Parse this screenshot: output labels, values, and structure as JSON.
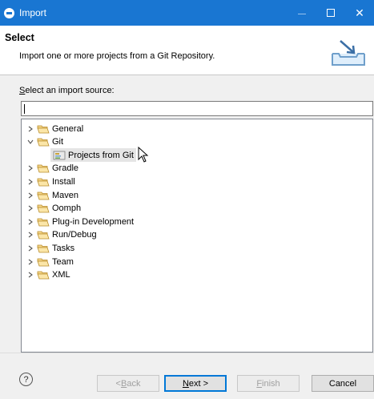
{
  "window": {
    "title": "Import"
  },
  "header": {
    "title": "Select",
    "description": "Import one or more projects from a Git Repository."
  },
  "source": {
    "label_accel": "S",
    "label_rest": "elect an import source:",
    "search_value": ""
  },
  "tree": {
    "items": [
      {
        "label": "General",
        "expanded": false,
        "icon": "folder-icon"
      },
      {
        "label": "Git",
        "expanded": true,
        "icon": "folder-icon"
      },
      {
        "label": "Projects from Git",
        "child": true,
        "selected": true,
        "icon": "git-projects-icon"
      },
      {
        "label": "Gradle",
        "expanded": false,
        "icon": "folder-icon"
      },
      {
        "label": "Install",
        "expanded": false,
        "icon": "folder-icon"
      },
      {
        "label": "Maven",
        "expanded": false,
        "icon": "folder-icon"
      },
      {
        "label": "Oomph",
        "expanded": false,
        "icon": "folder-icon"
      },
      {
        "label": "Plug-in Development",
        "expanded": false,
        "icon": "folder-icon"
      },
      {
        "label": "Run/Debug",
        "expanded": false,
        "icon": "folder-icon"
      },
      {
        "label": "Tasks",
        "expanded": false,
        "icon": "folder-icon"
      },
      {
        "label": "Team",
        "expanded": false,
        "icon": "folder-icon"
      },
      {
        "label": "XML",
        "expanded": false,
        "icon": "folder-icon"
      }
    ]
  },
  "buttons": {
    "back": {
      "pre": "< ",
      "accel": "B",
      "post": "ack",
      "enabled": false
    },
    "next": {
      "accel": "N",
      "post": "ext >",
      "enabled": true
    },
    "finish": {
      "accel": "F",
      "post": "inish",
      "enabled": false
    },
    "cancel": {
      "label": "Cancel",
      "enabled": true
    }
  },
  "colors": {
    "titlebar": "#1976d2",
    "selection": "#e5e5e5",
    "default_button_border": "#0078d7"
  }
}
